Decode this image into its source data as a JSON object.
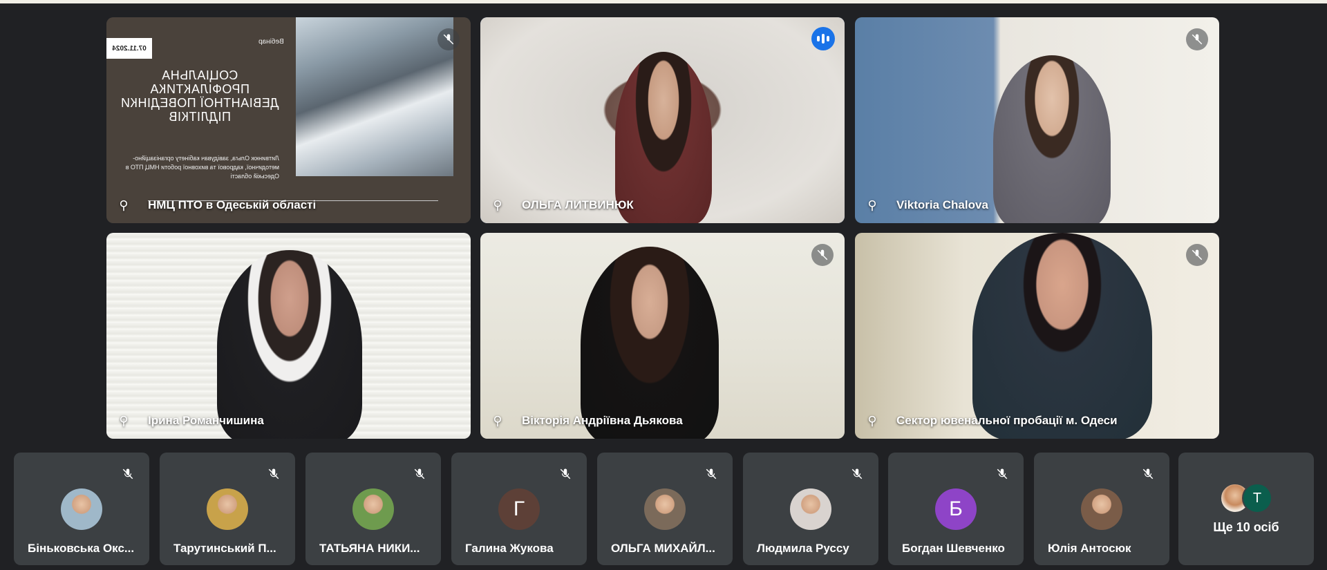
{
  "main_tiles": [
    {
      "name": "НМЦ ПТО в Одеській області",
      "muted": true
    },
    {
      "name": "ОЛЬГА ЛИТВИНЮК",
      "speaking": true
    },
    {
      "name": "Viktoria Chalova",
      "muted": true
    },
    {
      "name": "Ірина Романчишина",
      "muted": false
    },
    {
      "name": "Вікторія Андріївна Дьякова",
      "muted": true
    },
    {
      "name": "Сектор ювенальної пробації м. Одеси",
      "muted": true
    }
  ],
  "slide": {
    "date": "07.11.2024",
    "label": "Вебінар",
    "title": "СОЦІАЛЬНА ПРОФІЛАКТИКА ДЕВІАНТНОЇ ПОВЕДІНКИ ПІДЛІТКІВ",
    "author": "Литвинюк Ольга, завідувач кабінету організаційно-методичної, кадрової та виховної роботи НМЦ ПТО в Одеській області"
  },
  "strip": [
    {
      "name": "Біньковська Окс...",
      "avatar_letter": "",
      "avatar_color": "#9fb8c9"
    },
    {
      "name": "Тарутинський П...",
      "avatar_letter": "",
      "avatar_color": "#c8a24a"
    },
    {
      "name": "ТАТЬЯНА НИКИ...",
      "avatar_letter": "",
      "avatar_color": "#6e9b4e"
    },
    {
      "name": "Галина Жукова",
      "avatar_letter": "Г",
      "avatar_color": "#5d4037"
    },
    {
      "name": "ОЛЬГА МИХАЙЛ...",
      "avatar_letter": "",
      "avatar_color": "#7b6a5a"
    },
    {
      "name": "Людмила Руссу",
      "avatar_letter": "",
      "avatar_color": "#d9d3cf"
    },
    {
      "name": "Богдан Шевченко",
      "avatar_letter": "Б",
      "avatar_color": "#8e44c7"
    },
    {
      "name": "Юлія Антосюк",
      "avatar_letter": "",
      "avatar_color": "#7a5c48"
    }
  ],
  "more": {
    "label": "Ще 10 осіб",
    "avatar_letter": "Т"
  },
  "colors": {
    "background": "#202124",
    "tile": "#3c4043",
    "active_border": "#8ab4f8",
    "speaking": "#1a73e8"
  }
}
